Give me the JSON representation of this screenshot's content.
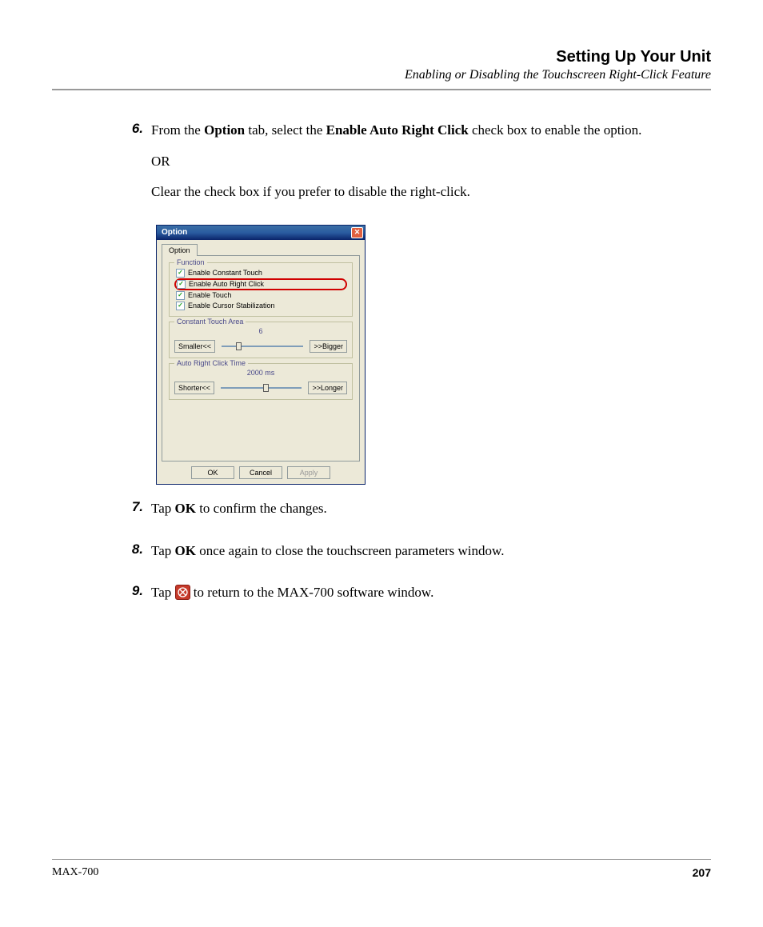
{
  "header": {
    "title": "Setting Up Your Unit",
    "subtitle": "Enabling or Disabling the Touchscreen Right-Click Feature"
  },
  "steps": {
    "s6": {
      "num": "6.",
      "p1_a": "From the ",
      "p1_b": "Option",
      "p1_c": " tab, select the ",
      "p1_d": "Enable Auto Right Click",
      "p1_e": " check box to enable the option.",
      "p2": "OR",
      "p3": "Clear the check box if you prefer to disable the right-click."
    },
    "s7": {
      "num": "7.",
      "a": "Tap ",
      "b": "OK",
      "c": " to confirm the changes."
    },
    "s8": {
      "num": "8.",
      "a": "Tap ",
      "b": "OK",
      "c": " once again to close the touchscreen parameters window."
    },
    "s9": {
      "num": "9.",
      "a": "Tap ",
      "c": " to return to the MAX-700 software window."
    }
  },
  "dialog": {
    "title": "Option",
    "tab": "Option",
    "function_legend": "Function",
    "chk1": "Enable Constant Touch",
    "chk2": "Enable Auto Right Click",
    "chk3": "Enable Touch",
    "chk4": "Enable Cursor Stabilization",
    "area_legend": "Constant Touch Area",
    "area_value": "6",
    "smaller": "Smaller<<",
    "bigger": ">>Bigger",
    "time_legend": "Auto Right Click Time",
    "time_value": "2000 ms",
    "shorter": "Shorter<<",
    "longer": ">>Longer",
    "ok": "OK",
    "cancel": "Cancel",
    "apply": "Apply"
  },
  "footer": {
    "left": "MAX-700",
    "right": "207"
  }
}
